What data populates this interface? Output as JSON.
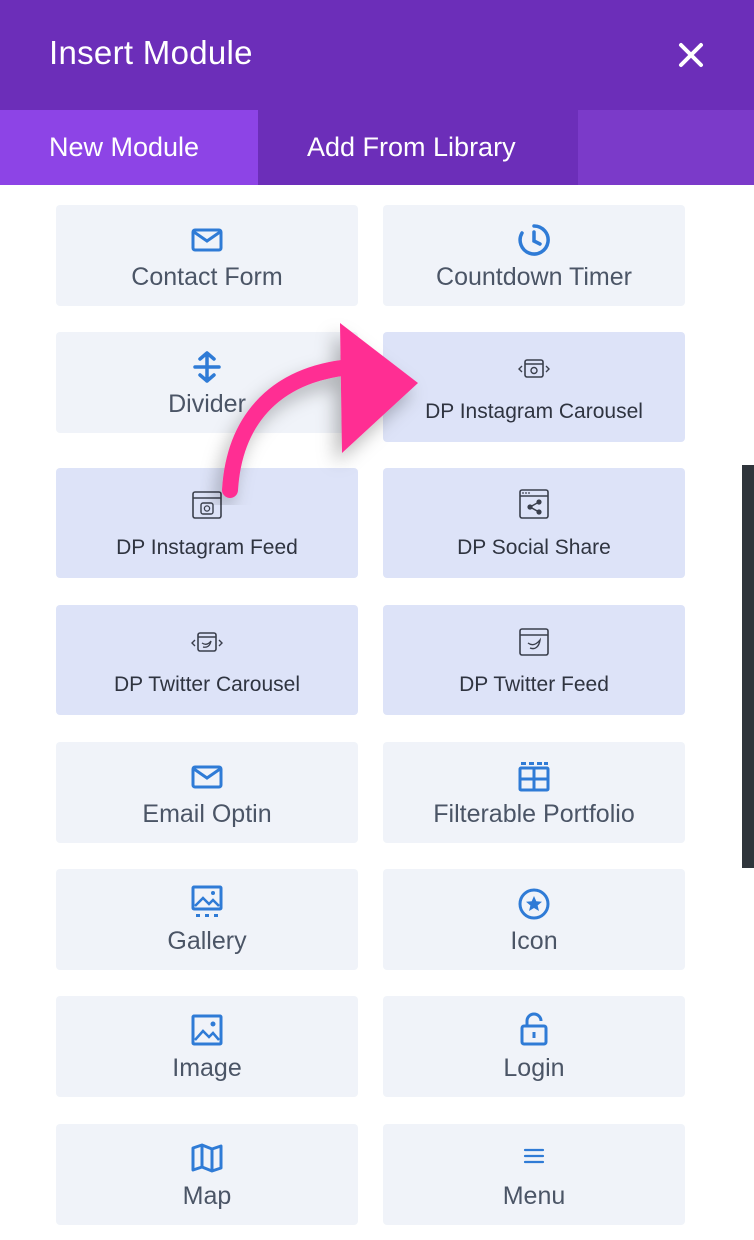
{
  "header": {
    "title": "Insert Module",
    "close_icon": "close-icon"
  },
  "tabs": [
    {
      "label": "New Module",
      "active": true
    },
    {
      "label": "Add From Library",
      "active": false
    }
  ],
  "colors": {
    "header_bg": "#6c2eb9",
    "tab_active_bg": "#8d44e6",
    "icon_blue": "#2f7bd6",
    "dp_card_bg": "#dde3f8",
    "card_bg": "#f0f3f9",
    "arrow_pink": "#ff2e93"
  },
  "modules": [
    {
      "label": "Contact Form",
      "icon": "envelope-icon",
      "dp": false
    },
    {
      "label": "Countdown Timer",
      "icon": "clock-icon",
      "dp": false
    },
    {
      "label": "Divider",
      "icon": "vertical-arrows-icon",
      "dp": false
    },
    {
      "label": "DP Instagram Carousel",
      "icon": "instagram-carousel-icon",
      "dp": true
    },
    {
      "label": "DP Instagram Feed",
      "icon": "instagram-feed-icon",
      "dp": true
    },
    {
      "label": "DP Social Share",
      "icon": "social-share-icon",
      "dp": true
    },
    {
      "label": "DP Twitter Carousel",
      "icon": "twitter-carousel-icon",
      "dp": true
    },
    {
      "label": "DP Twitter Feed",
      "icon": "twitter-feed-icon",
      "dp": true
    },
    {
      "label": "Email Optin",
      "icon": "envelope-icon",
      "dp": false
    },
    {
      "label": "Filterable Portfolio",
      "icon": "grid-icon",
      "dp": false
    },
    {
      "label": "Gallery",
      "icon": "gallery-icon",
      "dp": false
    },
    {
      "label": "Icon",
      "icon": "star-circle-icon",
      "dp": false
    },
    {
      "label": "Image",
      "icon": "image-icon",
      "dp": false
    },
    {
      "label": "Login",
      "icon": "lock-icon",
      "dp": false
    },
    {
      "label": "Map",
      "icon": "map-icon",
      "dp": false
    },
    {
      "label": "Menu",
      "icon": "hamburger-icon",
      "dp": false
    }
  ]
}
